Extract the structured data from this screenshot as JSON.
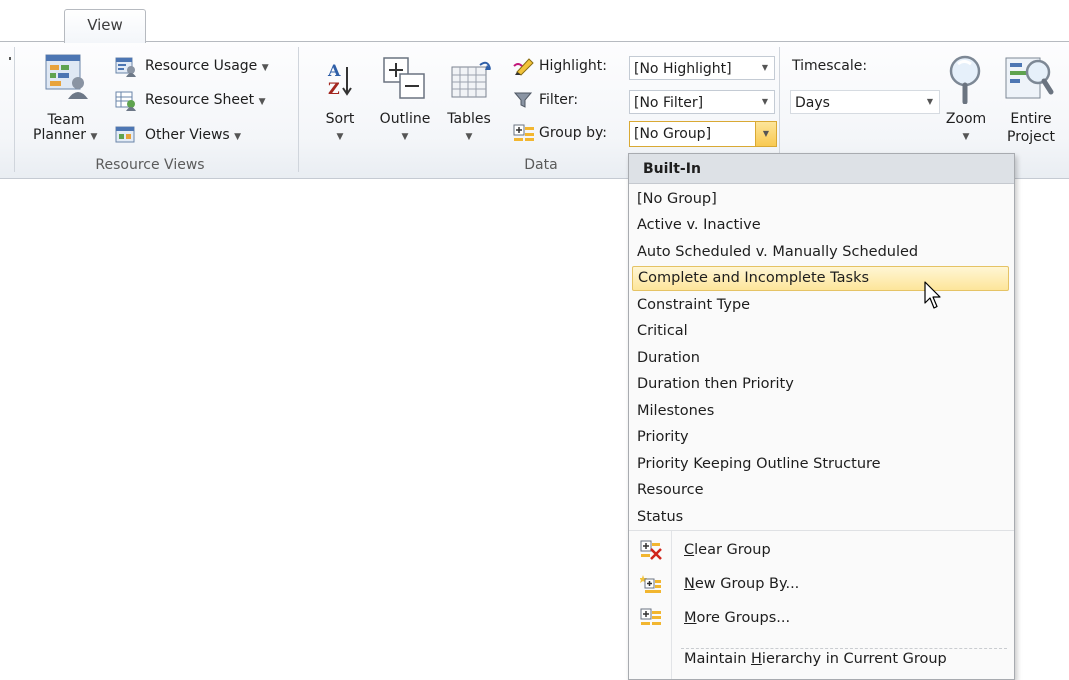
{
  "tabs": [
    {
      "label": "View"
    }
  ],
  "groups": {
    "resource_views": {
      "label": "Resource Views",
      "team_planner": {
        "line1": "Team",
        "line2": "Planner"
      },
      "resource_usage": "Resource Usage",
      "resource_sheet": "Resource Sheet",
      "other_views": "Other Views"
    },
    "data": {
      "label": "Data",
      "sort": "Sort",
      "outline": "Outline",
      "tables": "Tables",
      "highlight_label": "Highlight:",
      "highlight_value": "[No Highlight]",
      "filter_label": "Filter:",
      "filter_value": "[No Filter]",
      "groupby_label": "Group by:",
      "groupby_value": "[No Group]"
    },
    "zoom": {
      "timescale_label": "Timescale:",
      "timescale_value": "Days",
      "zoom": "Zoom",
      "entire_project": {
        "line1": "Entire",
        "line2": "Project"
      }
    }
  },
  "dropdown": {
    "header": "Built-In",
    "items": [
      "[No Group]",
      "Active v. Inactive",
      "Auto Scheduled v. Manually Scheduled",
      "Complete and Incomplete Tasks",
      "Constraint Type",
      "Critical",
      "Duration",
      "Duration then Priority",
      "Milestones",
      "Priority",
      "Priority Keeping Outline Structure",
      "Resource",
      "Status"
    ],
    "highlighted_item": "Complete and Incomplete Tasks",
    "commands": {
      "clear_group": {
        "pre": "",
        "key": "C",
        "post": "lear Group"
      },
      "new_group_by": {
        "pre": "",
        "key": "N",
        "post": "ew Group By..."
      },
      "more_groups": {
        "pre": "",
        "key": "M",
        "post": "ore Groups..."
      },
      "maintain_hierarchy": {
        "pre": "Maintain ",
        "key": "H",
        "post": "ierarchy in Current Group"
      }
    }
  },
  "colors": {
    "accent_dropdown_button": "#f8c951",
    "highlight_fill": "#fde59a",
    "ribbon_bg": "#f4f6f9"
  },
  "icons": [
    "team-planner-icon",
    "resource-usage-icon",
    "resource-sheet-icon",
    "other-views-icon",
    "sort-az-icon",
    "outline-icon",
    "tables-icon",
    "highlight-pen-icon",
    "filter-funnel-icon",
    "group-by-icon",
    "zoom-magnifier-icon",
    "entire-project-icon",
    "clear-group-icon",
    "new-group-icon",
    "more-groups-icon",
    "mouse-pointer-icon"
  ]
}
